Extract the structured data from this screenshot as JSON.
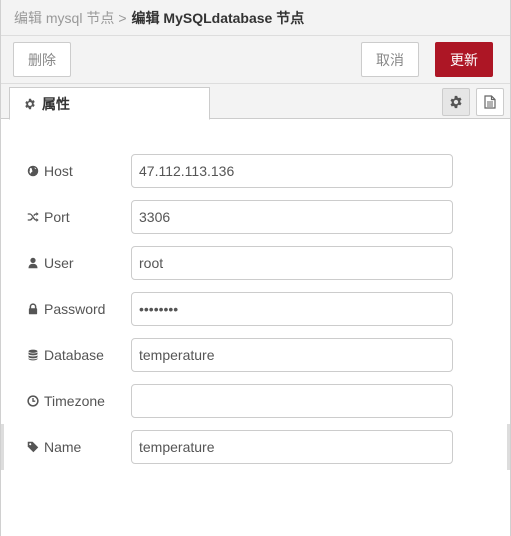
{
  "breadcrumb": {
    "parent": "编辑 mysql 节点",
    "separator": ">",
    "current": "编辑 MySQLdatabase 节点"
  },
  "toolbar": {
    "delete_label": "删除",
    "cancel_label": "取消",
    "update_label": "更新",
    "update_color": "#ad1625"
  },
  "tabs": [
    {
      "label": "属性",
      "icon": "gear-icon"
    }
  ],
  "form": {
    "fields": [
      {
        "label": "Host",
        "icon": "globe-icon",
        "value": "47.112.113.136",
        "type": "text"
      },
      {
        "label": "Port",
        "icon": "random-icon",
        "value": "3306",
        "type": "text"
      },
      {
        "label": "User",
        "icon": "user-icon",
        "value": "root",
        "type": "text"
      },
      {
        "label": "Password",
        "icon": "lock-icon",
        "value": "xxxxxxxx",
        "type": "password"
      },
      {
        "label": "Database",
        "icon": "database-icon",
        "value": "temperature",
        "type": "text"
      },
      {
        "label": "Timezone",
        "icon": "clock-icon",
        "value": "",
        "type": "text"
      },
      {
        "label": "Name",
        "icon": "tag-icon",
        "value": "temperature",
        "type": "text"
      }
    ]
  }
}
